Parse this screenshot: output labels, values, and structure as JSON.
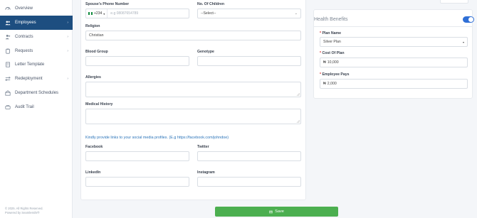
{
  "sidebar": {
    "items": [
      {
        "label": "Overview",
        "icon": "dashboard-icon",
        "has_submenu": false
      },
      {
        "label": "Employees",
        "icon": "users-icon",
        "has_submenu": true,
        "active": true
      },
      {
        "label": "Contracts",
        "icon": "user-plus-icon",
        "has_submenu": true
      },
      {
        "label": "Requests",
        "icon": "clipboard-icon",
        "has_submenu": true
      },
      {
        "label": "Letter Template",
        "icon": "document-icon",
        "has_submenu": false
      },
      {
        "label": "Redeployment",
        "icon": "swap-icon",
        "has_submenu": true
      },
      {
        "label": "Department Schedules",
        "icon": "building-icon",
        "has_submenu": false
      },
      {
        "label": "Audit Trail",
        "icon": "history-icon",
        "has_submenu": false
      }
    ],
    "footer_copyright": "© 2025. All Rights Reserved.",
    "footer_powered": "Powered by Seamlesshr®",
    "active_color": "#1d4e80"
  },
  "form": {
    "spouse_phone": {
      "label": "Spouse's Phone Number",
      "country_code": "+234",
      "placeholder": "e.g 08087654789",
      "value": ""
    },
    "children": {
      "label": "No. Of Children",
      "selected": "--Select--"
    },
    "religion": {
      "label": "Religion",
      "value": "Christian"
    },
    "blood_group": {
      "label": "Blood Group",
      "value": ""
    },
    "genotype": {
      "label": "Genotype",
      "value": ""
    },
    "allergies": {
      "label": "Allergies",
      "value": ""
    },
    "medical_history": {
      "label": "Medical History",
      "value": ""
    },
    "social_hint": "Kindly provide links to your social media profiles. (E.g https://facebook.com/johndoe)",
    "facebook": {
      "label": "Facebook",
      "value": ""
    },
    "twitter": {
      "label": "Twitter",
      "value": ""
    },
    "linkedin": {
      "label": "LinkedIn",
      "value": ""
    },
    "instagram": {
      "label": "Instagram",
      "value": ""
    }
  },
  "health_benefits": {
    "title": "Health Benefits",
    "enabled": true,
    "plan_name": {
      "label": "Plan Name",
      "selected": "Silver Plan"
    },
    "cost_of_plan": {
      "label": "Cost Of Plan",
      "currency": "₦",
      "value": "10,000"
    },
    "employee_pays": {
      "label": "Employee Pays",
      "currency": "₦",
      "value": "2,000"
    },
    "toggle_color": "#2f6fd6"
  },
  "actions": {
    "save_label": "Save",
    "save_color": "#4caf50"
  }
}
